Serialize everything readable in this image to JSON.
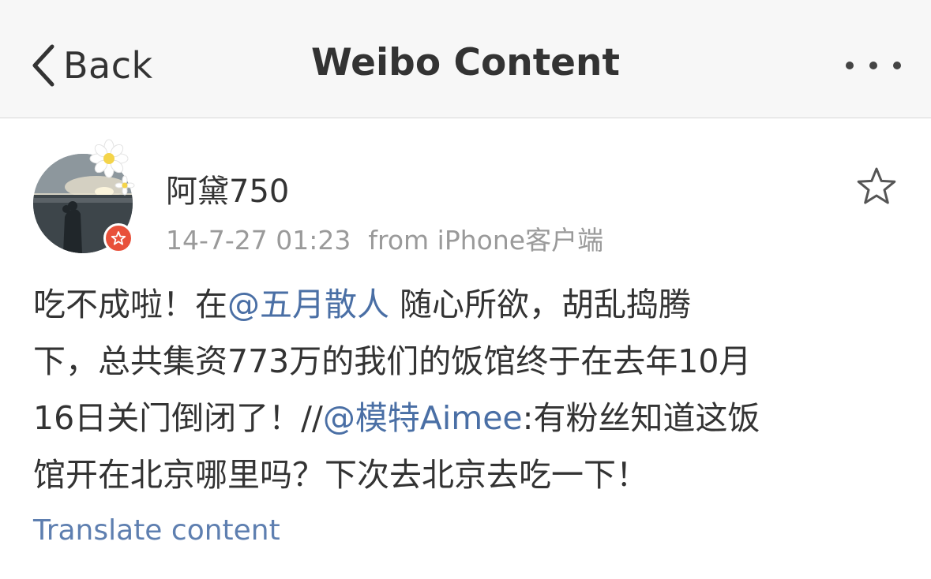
{
  "navbar": {
    "back_label": "Back",
    "title": "Weibo Content",
    "more_icon": "more-dots-icon"
  },
  "post": {
    "username": "阿黛750",
    "timestamp": "14-7-27 01:23",
    "source": "from iPhone客户端",
    "star_icon": "star-outline-icon",
    "lines": [
      [
        {
          "text": "吃不成啦！在",
          "mention": false
        },
        {
          "text": "@五月散人",
          "mention": true
        },
        {
          "text": " 随心所欲，胡乱捣腾",
          "mention": false
        }
      ],
      [
        {
          "text": "下，总共集资773万的我们的饭馆终于在去年10月",
          "mention": false
        }
      ],
      [
        {
          "text": "16日关门倒闭了！//",
          "mention": false
        },
        {
          "text": "@模特Aimee",
          "mention": true
        },
        {
          "text": ":有粉丝知道这饭",
          "mention": false
        }
      ],
      [
        {
          "text": "馆开在北京哪里吗？下次去北京去吃一下！",
          "mention": false
        }
      ]
    ],
    "translate_label": "Translate content"
  },
  "colors": {
    "navbar_bg": "#f7f7f7",
    "mention": "#4a6fa5",
    "link": "#5e7fb0",
    "meta": "#9a9a9a",
    "badge": "#e8503a"
  }
}
